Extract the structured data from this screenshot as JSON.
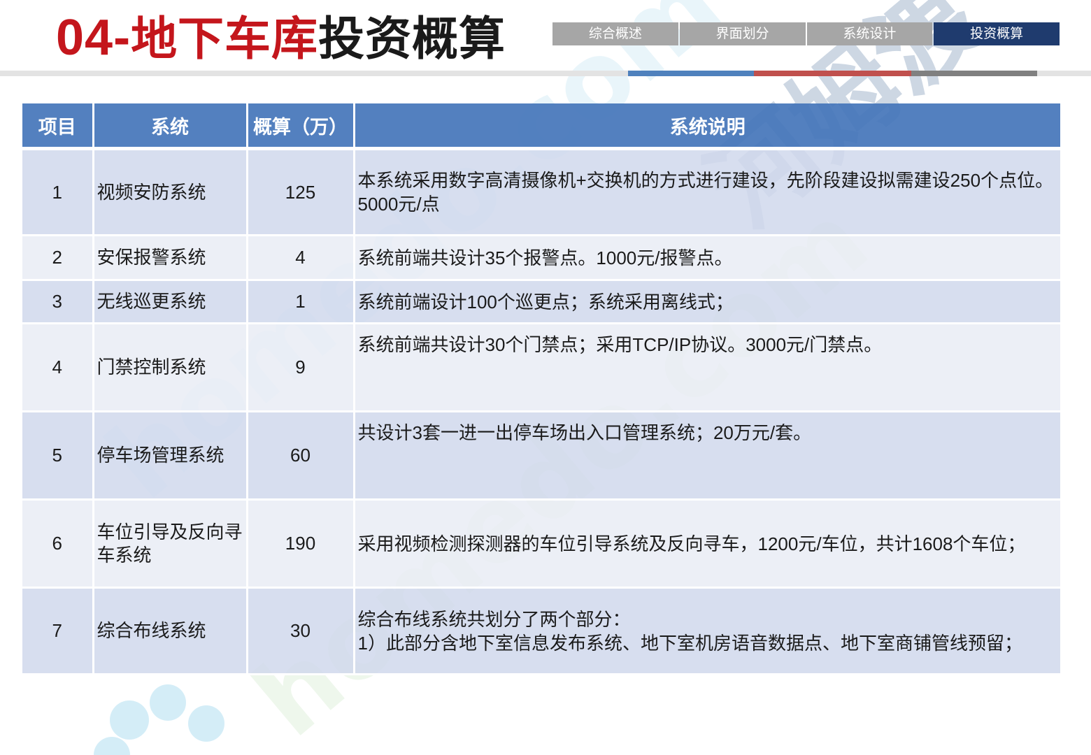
{
  "header": {
    "title_number": "04-",
    "title_red": "地下车库",
    "title_dark": "投资概算"
  },
  "nav": {
    "tabs": [
      {
        "label": "综合概述",
        "active": false
      },
      {
        "label": "界面划分",
        "active": false
      },
      {
        "label": "系统设计",
        "active": false
      },
      {
        "label": "投资概算",
        "active": true
      }
    ]
  },
  "table": {
    "headers": [
      "项目",
      "系统",
      "概算（万）",
      "系统说明"
    ],
    "rows": [
      {
        "idx": "1",
        "system": "视频安防系统",
        "amount": "125",
        "desc": [
          "本系统采用数字高清摄像机+交换机的方式进行建设，先阶段建设拟需建设250个点位。5000元/点"
        ]
      },
      {
        "idx": "2",
        "system": "安保报警系统",
        "amount": "4",
        "desc": [
          "系统前端共设计35个报警点。1000元/报警点。"
        ]
      },
      {
        "idx": "3",
        "system": "无线巡更系统",
        "amount": "1",
        "desc": [
          "系统前端设计100个巡更点；系统采用离线式；"
        ]
      },
      {
        "idx": "4",
        "system": "门禁控制系统",
        "amount": "9",
        "desc": [
          "系统前端共设计30个门禁点；采用TCP/IP协议。3000元/门禁点。"
        ]
      },
      {
        "idx": "5",
        "system": "停车场管理系统",
        "amount": "60",
        "desc": [
          "共设计3套一进一出停车场出入口管理系统；20万元/套。"
        ]
      },
      {
        "idx": "6",
        "system": "车位引导及反向寻车系统",
        "amount": "190",
        "desc": [
          "采用视频检测探测器的车位引导系统及反向寻车，1200元/车位，共计1608个车位；"
        ]
      },
      {
        "idx": "7",
        "system": "综合布线系统",
        "amount": "30",
        "desc": [
          "综合布线系统共划分了两个部分：",
          "1）此部分含地下室信息发布系统、地下室机房语音数据点、地下室商铺管线预留；"
        ]
      }
    ]
  },
  "watermark": {
    "text": "homedo.com",
    "cn_text": "河姆渡"
  },
  "colors": {
    "title_red": "#c4161c",
    "header_blue": "#4475ba",
    "nav_active": "#1f3b6e",
    "nav_inactive": "#a6a6a6",
    "row_odd": "#d0d8ec",
    "row_even": "#e9ecf4"
  }
}
